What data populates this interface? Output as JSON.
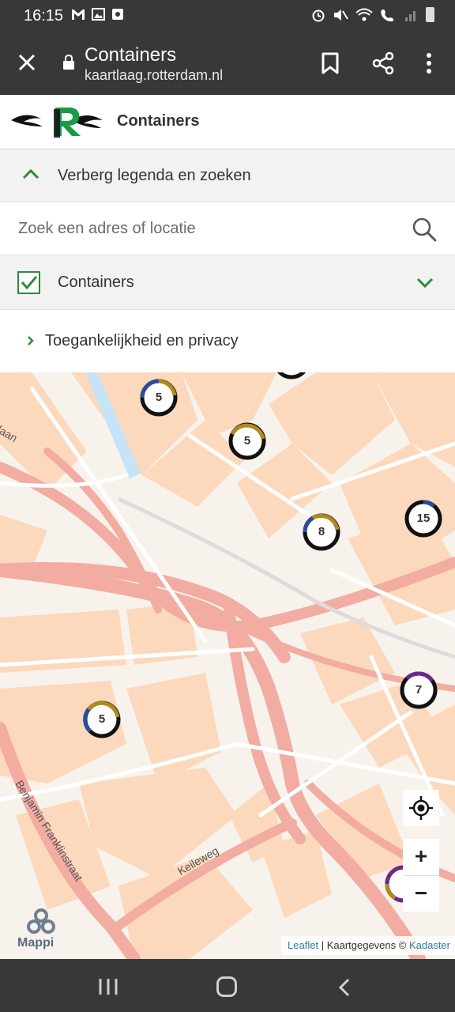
{
  "status_bar": {
    "time": "16:15",
    "left_icons": [
      "gmail-icon",
      "gallery-icon",
      "app-icon"
    ],
    "right_icons": [
      "alarm-icon",
      "mute-icon",
      "wifi-icon",
      "wifi-call-icon",
      "signal-icon",
      "battery-icon"
    ]
  },
  "browser": {
    "title": "Containers",
    "url": "kaartlaag.rotterdam.nl"
  },
  "app_header": {
    "title": "Containers",
    "logo": "rotterdam-logo"
  },
  "panel": {
    "toggle_label": "Verberg legenda en zoeken",
    "search_placeholder": "Zoek een adres of locatie",
    "layer_label": "Containers",
    "layer_checked": true,
    "accessibility_label": "Toegankelijkheid en privacy"
  },
  "map": {
    "clusters": [
      {
        "count": "5"
      },
      {
        "count": "5"
      },
      {
        "count": "8"
      },
      {
        "count": "15"
      },
      {
        "count": "7"
      },
      {
        "count": "5"
      }
    ],
    "streets": [
      "laan",
      "Benjamin Franklinstraat",
      "Keileweg"
    ],
    "controls": {
      "zoom_in": "+",
      "zoom_out": "−"
    },
    "brand": "Mappi",
    "attribution": {
      "leaflet": "Leaflet",
      "separator": " | Kaartgegevens © ",
      "source": "Kadaster"
    }
  },
  "colors": {
    "chrome": "#383838",
    "accent_green": "#2e8a3a",
    "ring_gold": "#b08a1e",
    "ring_blue": "#2a4c9c",
    "ring_purple": "#6b2a8a",
    "road": "#f2a8a0",
    "building": "#fcd7b8"
  }
}
